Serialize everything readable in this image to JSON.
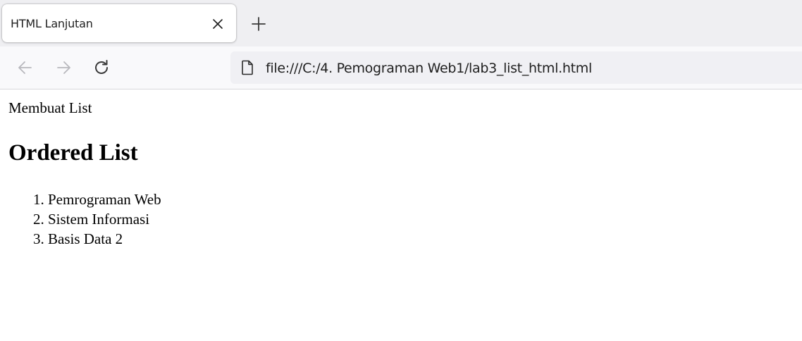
{
  "browser": {
    "tab": {
      "title": "HTML Lanjutan"
    },
    "address_bar": {
      "url": "file:///C:/4. Pemograman Web1/lab3_list_html.html"
    },
    "icons": [
      "close-icon",
      "plus-icon",
      "back-arrow-icon",
      "forward-arrow-icon",
      "reload-icon",
      "page-icon"
    ]
  },
  "page": {
    "intro": "Membuat List",
    "heading": "Ordered List",
    "items": [
      {
        "number": "1.",
        "label": "Pemrograman Web"
      },
      {
        "number": "2.",
        "label": "Sistem Informasi"
      },
      {
        "number": "3.",
        "label": "Basis Data 2"
      }
    ]
  }
}
